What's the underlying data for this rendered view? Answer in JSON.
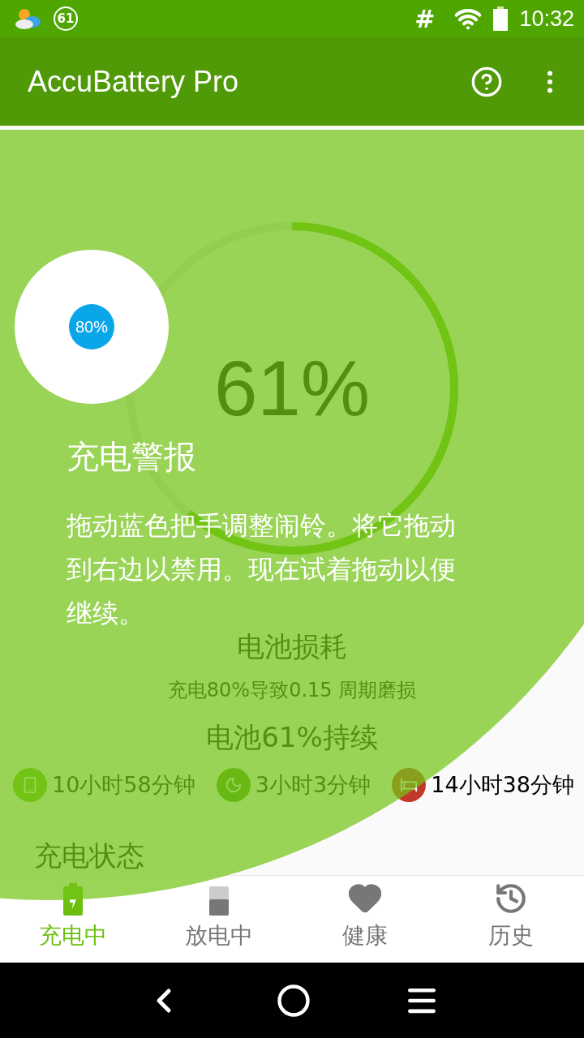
{
  "status_bar": {
    "badge": "61",
    "signal_text": "#",
    "time": "10:32"
  },
  "app_bar": {
    "title": "AccuBattery Pro"
  },
  "gauge": {
    "percent": "61%",
    "level": 0.61
  },
  "wear": {
    "title": "电池损耗",
    "detail": "充电80%导致0.15 周期磨损"
  },
  "estimate": {
    "title": "电池61%持续",
    "items": [
      {
        "kind": "screen_on",
        "value": "10小时58分钟"
      },
      {
        "kind": "screen_off",
        "value": "3小时3分钟"
      },
      {
        "kind": "sleep",
        "value": "14小时38分钟"
      }
    ]
  },
  "section_title": "充电状态",
  "tabs": [
    {
      "kind": "charging",
      "label": "充电中",
      "selected": true
    },
    {
      "kind": "discharging",
      "label": "放电中",
      "selected": false
    },
    {
      "kind": "health",
      "label": "健康",
      "selected": false
    },
    {
      "kind": "history",
      "label": "历史",
      "selected": false
    }
  ],
  "showcase": {
    "handle": "80%",
    "title": "充电警报",
    "body": "拖动蓝色把手调整闹铃。将它拖动到右边以禁用。现在试着拖动以便继续。"
  }
}
